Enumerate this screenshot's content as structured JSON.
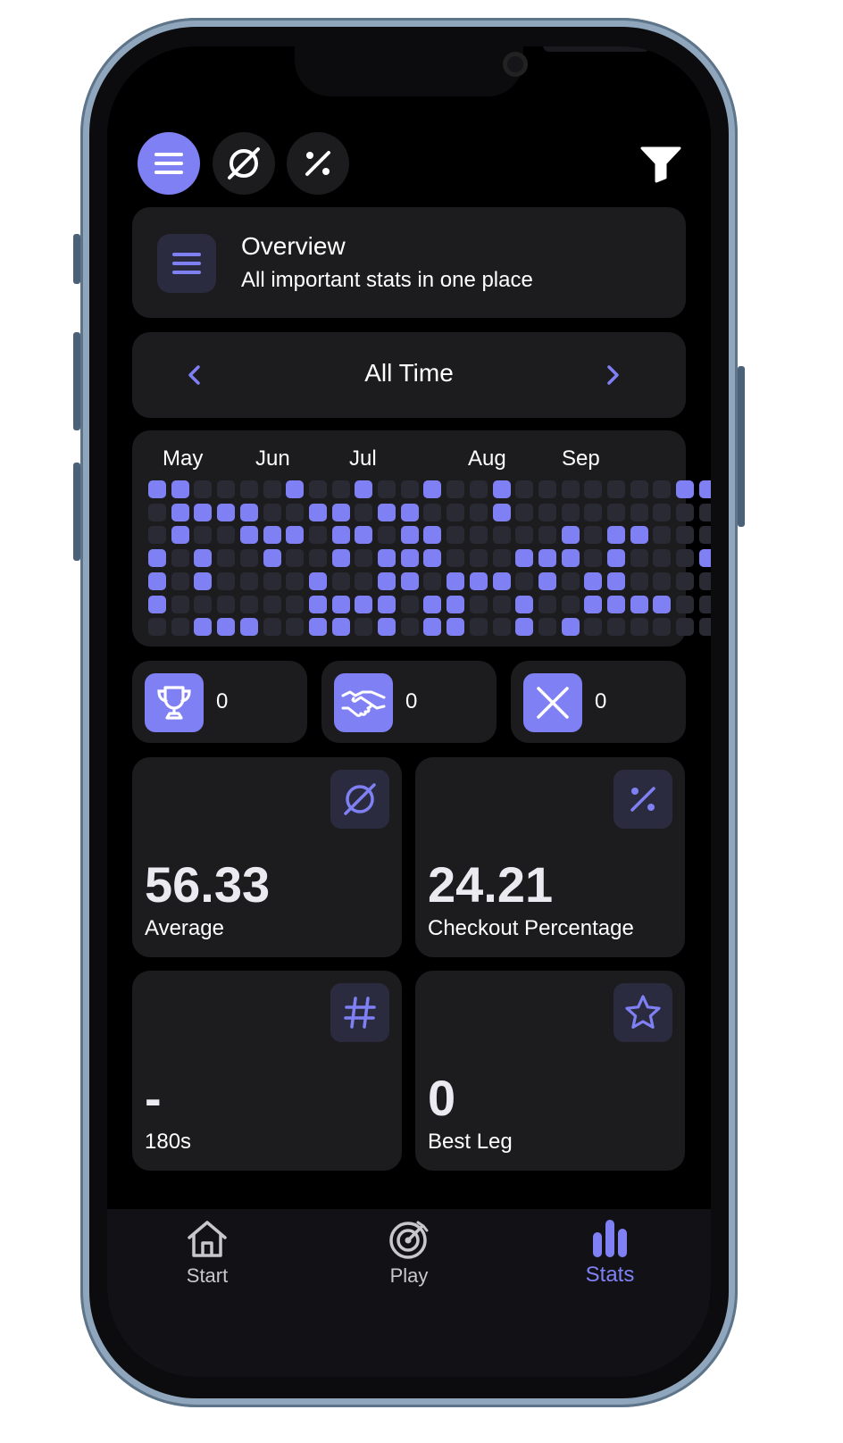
{
  "toolbar": {
    "overview_icon": "list-icon",
    "average_icon": "average-icon",
    "percentage_icon": "percent-icon",
    "filter_icon": "filter-icon",
    "accent_color": "#8080f5"
  },
  "overview": {
    "title": "Overview",
    "subtitle": "All important stats in one place",
    "icon": "list-icon"
  },
  "period": {
    "label": "All Time",
    "prev_icon": "chevron-left-icon",
    "next_icon": "chevron-right-icon"
  },
  "heatmap": {
    "months": [
      "May",
      "Jun",
      "Jul",
      "Aug",
      "Sep"
    ],
    "rows": [
      "1100001001001001000000011",
      "0111100110110001000000000",
      "0100111011011000001011000",
      "1010010010111000111010001",
      "1010000100110111010110000",
      "1000000111101100100111100",
      "0011100110101100101000000"
    ]
  },
  "results": [
    {
      "name": "wins",
      "icon": "trophy-icon",
      "value": "0"
    },
    {
      "name": "draws",
      "icon": "handshake-icon",
      "value": "0"
    },
    {
      "name": "losses",
      "icon": "x-icon",
      "value": "0"
    }
  ],
  "stats": {
    "average": {
      "value": "56.33",
      "label": "Average",
      "icon": "average-icon"
    },
    "checkout": {
      "value": "24.21",
      "label": "Checkout Percentage",
      "icon": "percent-icon"
    },
    "one_eighties": {
      "value": "-",
      "label": "180s",
      "icon": "hash-icon"
    },
    "best_leg": {
      "value": "0",
      "label": "Best Leg",
      "icon": "star-icon"
    }
  },
  "nav": {
    "start": "Start",
    "play": "Play",
    "stats": "Stats",
    "active": "stats"
  }
}
